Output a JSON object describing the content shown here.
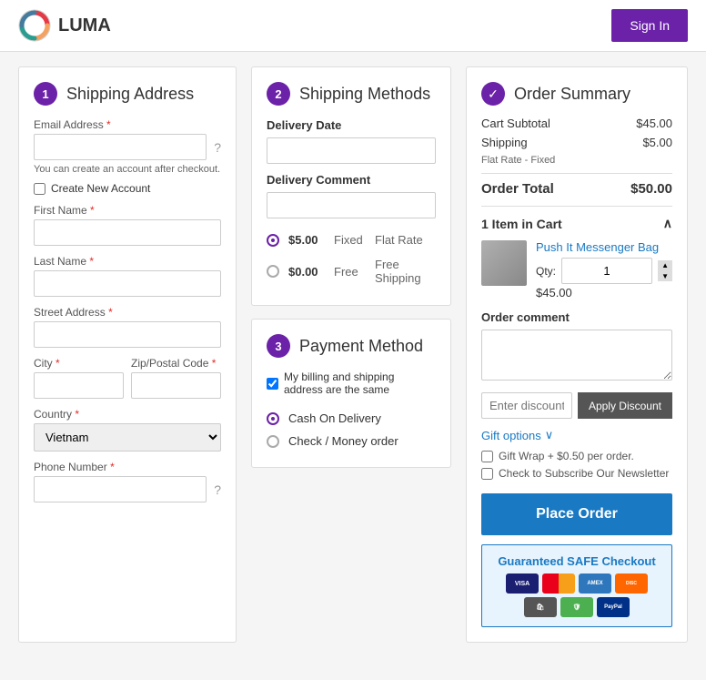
{
  "header": {
    "logo_text": "LUMA",
    "sign_in_label": "Sign In"
  },
  "shipping_address": {
    "step": "1",
    "title": "Shipping Address",
    "email_label": "Email Address",
    "email_required": true,
    "hint": "You can create an account after checkout.",
    "create_account_label": "Create New Account",
    "first_name_label": "First Name",
    "last_name_label": "Last Name",
    "street_label": "Street Address",
    "city_label": "City",
    "zip_label": "Zip/Postal Code",
    "country_label": "Country",
    "country_value": "Vietnam",
    "phone_label": "Phone Number"
  },
  "shipping_methods": {
    "step": "2",
    "title": "Shipping Methods",
    "delivery_date_label": "Delivery Date",
    "delivery_comment_label": "Delivery Comment",
    "options": [
      {
        "price": "$5.00",
        "type": "Fixed",
        "name": "Flat Rate",
        "selected": true
      },
      {
        "price": "$0.00",
        "type": "Free",
        "name": "Free Shipping",
        "selected": false
      }
    ]
  },
  "payment_method": {
    "step": "3",
    "title": "Payment Method",
    "same_address_label": "My billing and shipping address are the same",
    "options": [
      {
        "name": "Cash On Delivery",
        "selected": true
      },
      {
        "name": "Check / Money order",
        "selected": false
      }
    ]
  },
  "order_summary": {
    "title": "Order Summary",
    "cart_subtotal_label": "Cart Subtotal",
    "cart_subtotal_value": "$45.00",
    "shipping_label": "Shipping",
    "shipping_value": "$5.00",
    "shipping_method": "Flat Rate - Fixed",
    "order_total_label": "Order Total",
    "order_total_value": "$50.00",
    "cart_count_label": "1 Item in Cart",
    "item": {
      "name": "Push It Messenger Bag",
      "qty": "1",
      "price": "$45.00"
    },
    "order_comment_label": "Order comment",
    "discount_placeholder": "Enter discount code",
    "apply_label": "Apply Discount",
    "gift_options_label": "Gift options",
    "gift_wrap_label": "Gift Wrap + $0.50 per order.",
    "newsletter_label": "Check to Subscribe Our Newsletter",
    "place_order_label": "Place Order",
    "safe_checkout_label": "Guaranteed SAFE Checkout"
  }
}
